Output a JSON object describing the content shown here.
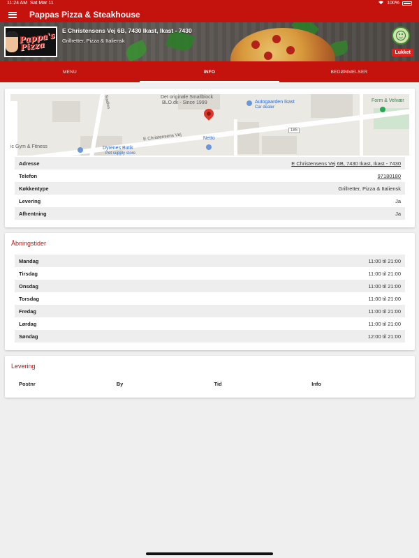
{
  "status_bar": {
    "time": "11:24 AM",
    "date": "Sat Mar 11",
    "battery": "100%"
  },
  "app_bar": {
    "title": "Pappas Pizza & Steakhouse"
  },
  "hero": {
    "logo_line1": "Pappa's",
    "logo_line2": "Pizza",
    "address": "E Christensens Vej 6B, 7430 Ikast, Ikast - 7430",
    "cuisine": "Grillretter, Pizza & Italiensk",
    "status_badge": "Lukket",
    "status_color": "#e2211a"
  },
  "tabs": [
    {
      "label": "Menu",
      "active": false
    },
    {
      "label": "Info",
      "active": true
    },
    {
      "label": "Bedømmelser",
      "active": false
    }
  ],
  "map": {
    "labels": {
      "smallblock_1": "Det originale Smallblock",
      "smallblock_2": "BLO.dk - Since 1999",
      "autogaarden": "Autogaarden Ikast",
      "car_dealer": "Car dealer",
      "form": "Form & Velvær",
      "street_1": "E Christensens Vej",
      "street_2": "Stadion",
      "gym": "ic Gym & Fitness",
      "dyrenes": "Dyrenes Butik",
      "pet_store": "Pet supply store",
      "netto": "Netto",
      "road_num": "185"
    }
  },
  "details": [
    {
      "label": "Adresse",
      "value": "E Christensens Vej 6B, 7430 Ikast, Ikast - 7430",
      "link": true
    },
    {
      "label": "Telefon",
      "value": "97180180",
      "link": true
    },
    {
      "label": "Køkkentype",
      "value": "Grillretter, Pizza & Italiensk",
      "link": false
    },
    {
      "label": "Levering",
      "value": "Ja",
      "link": false
    },
    {
      "label": "Afhentning",
      "value": "Ja",
      "link": false
    }
  ],
  "hours": {
    "title": "Åbningstider",
    "rows": [
      {
        "day": "Mandag",
        "time": "11:00 til 21:00"
      },
      {
        "day": "Tirsdag",
        "time": "11:00 til 21:00"
      },
      {
        "day": "Onsdag",
        "time": "11:00 til 21:00"
      },
      {
        "day": "Torsdag",
        "time": "11:00 til 21:00"
      },
      {
        "day": "Fredag",
        "time": "11:00 til 21:00"
      },
      {
        "day": "Lørdag",
        "time": "11:00 til 21:00"
      },
      {
        "day": "Søndag",
        "time": "12:00 til 21:00"
      }
    ]
  },
  "delivery": {
    "title": "Levering",
    "columns": [
      "Postnr",
      "By",
      "Tid",
      "Info"
    ]
  },
  "colors": {
    "brand": "#c4120c",
    "map_pin": "#e0352b"
  },
  "icons": {
    "menu": "hamburger-menu-icon",
    "wifi": "wifi-icon",
    "battery": "battery-icon",
    "pin": "map-pin-icon",
    "smiley": "smiley-icon"
  }
}
